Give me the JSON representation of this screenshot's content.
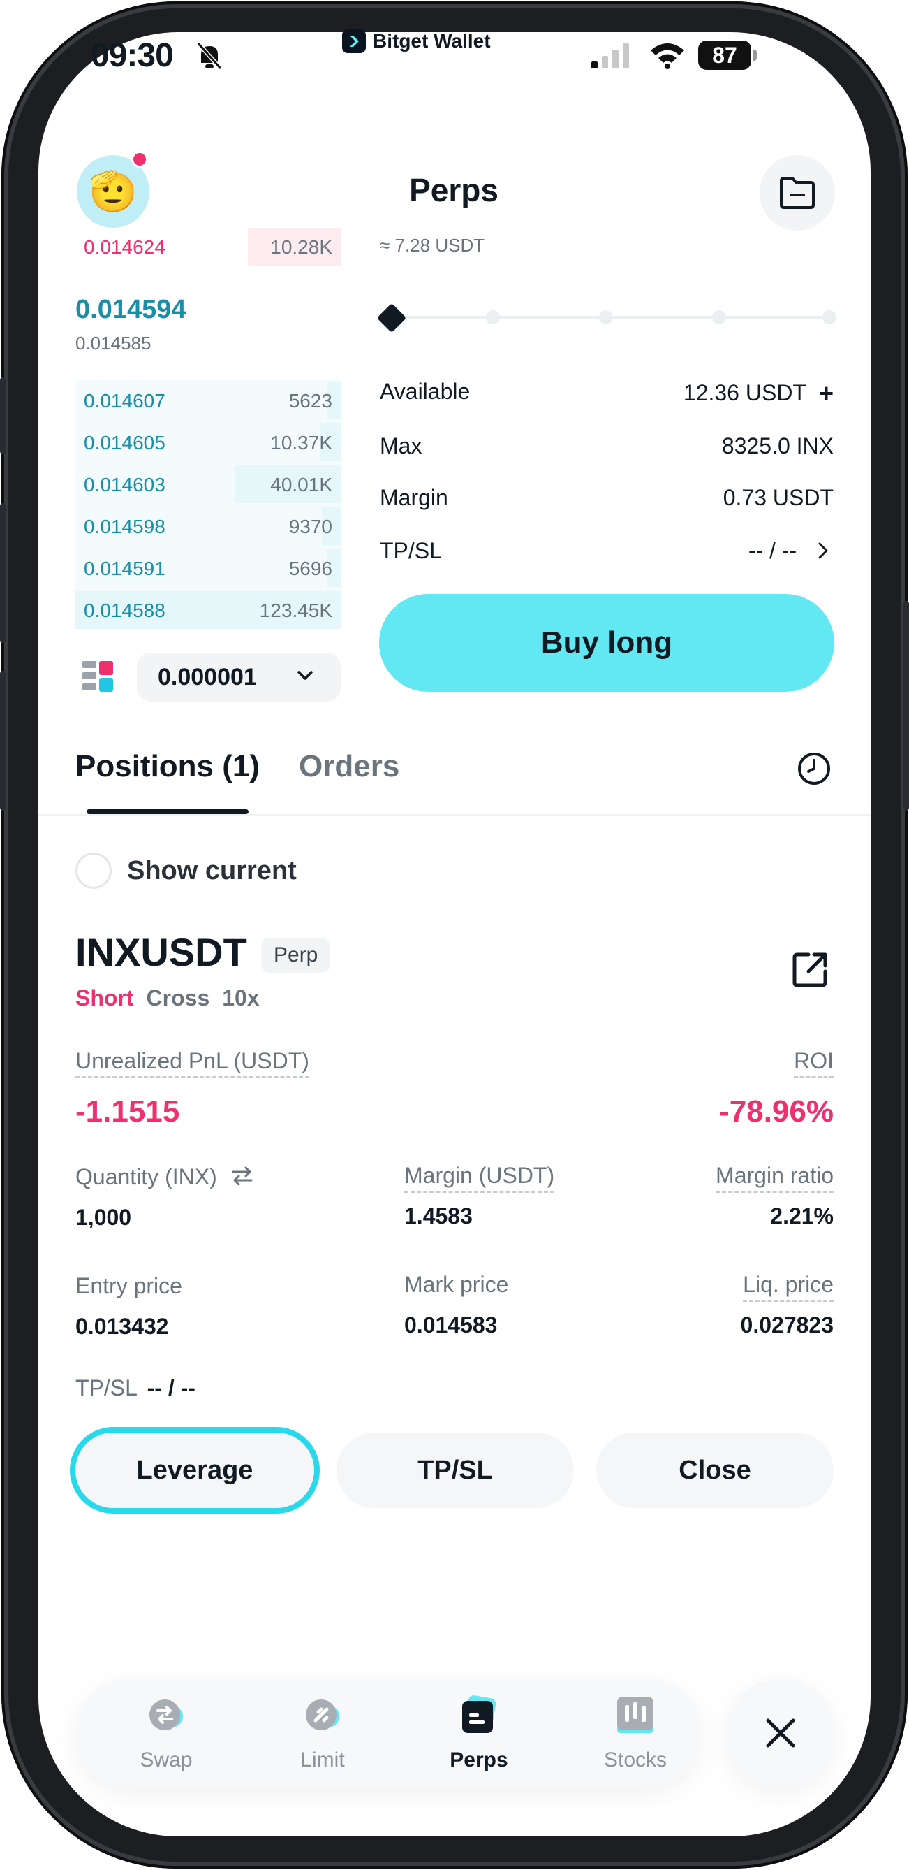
{
  "status_bar": {
    "time": "09:30",
    "brand": "Bitget Wallet",
    "battery": "87"
  },
  "header": {
    "title": "Perps"
  },
  "order_book": {
    "asks": [
      {
        "price": "0.014624",
        "qty": "10.28K",
        "depth": 0.35
      }
    ],
    "last_price": "0.014594",
    "mark_price": "0.014585",
    "bids": [
      {
        "price": "0.014607",
        "qty": "5623",
        "depth": 0.05
      },
      {
        "price": "0.014605",
        "qty": "10.37K",
        "depth": 0.08
      },
      {
        "price": "0.014603",
        "qty": "40.01K",
        "depth": 0.4
      },
      {
        "price": "0.014598",
        "qty": "9370",
        "depth": 0.07
      },
      {
        "price": "0.014591",
        "qty": "5696",
        "depth": 0.05
      },
      {
        "price": "0.014588",
        "qty": "123.45K",
        "depth": 1.0
      }
    ],
    "precision": "0.000001"
  },
  "trade_panel": {
    "approx_value": "≈ 7.28 USDT",
    "slider_value": 0,
    "available_label": "Available",
    "available_value": "12.36 USDT",
    "max_label": "Max",
    "max_value": "8325.0 INX",
    "margin_label": "Margin",
    "margin_value": "0.73 USDT",
    "tpsl_label": "TP/SL",
    "tpsl_value": "-- / --",
    "buy_button": "Buy long"
  },
  "tabs": {
    "positions": "Positions (1)",
    "orders": "Orders"
  },
  "show_current": "Show current",
  "position": {
    "symbol": "INXUSDT",
    "badge": "Perp",
    "side": "Short",
    "mode": "Cross",
    "leverage": "10x",
    "pnl_label": "Unrealized PnL (USDT)",
    "pnl_value": "-1.1515",
    "roi_label": "ROI",
    "roi_value": "-78.96%",
    "quantity_label": "Quantity (INX)",
    "quantity_value": "1,000",
    "margin_label": "Margin (USDT)",
    "margin_value": "1.4583",
    "margin_ratio_label": "Margin ratio",
    "margin_ratio_value": "2.21%",
    "entry_label": "Entry price",
    "entry_value": "0.013432",
    "mark_label": "Mark price",
    "mark_value": "0.014583",
    "liq_label": "Liq. price",
    "liq_value": "0.027823",
    "tpsl_label": "TP/SL",
    "tpsl_value": "-- / --",
    "buttons": {
      "leverage": "Leverage",
      "tpsl": "TP/SL",
      "close": "Close"
    }
  },
  "bottom_nav": {
    "items": [
      {
        "label": "Swap",
        "icon": "swap-icon"
      },
      {
        "label": "Limit",
        "icon": "limit-icon"
      },
      {
        "label": "Perps",
        "icon": "perps-icon",
        "active": true
      },
      {
        "label": "Stocks",
        "icon": "stocks-icon"
      }
    ]
  },
  "colors": {
    "accent": "#62e8f3",
    "negative": "#f0306e",
    "bid": "#1a8ea6",
    "highlight": "#27d9ea"
  }
}
